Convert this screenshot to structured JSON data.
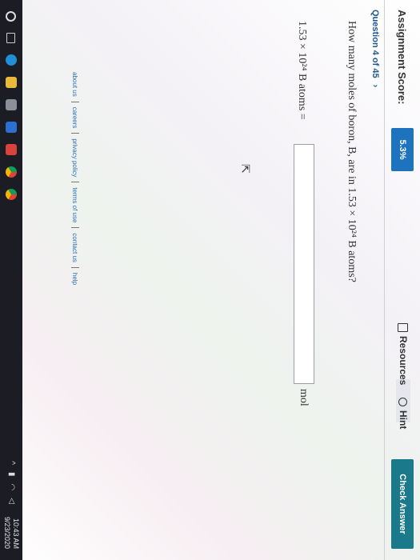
{
  "header": {
    "score_label": "Assignment Score:",
    "score_value": "5.3%",
    "resources_label": "Resources",
    "hint_label": "Hint",
    "check_answer_label": "Check Answer"
  },
  "question_nav": {
    "label": "Question 4 of 45",
    "next_glyph": "›"
  },
  "question": {
    "text": "How many moles of boron, B, are in 1.53 × 10²⁴ B atoms?",
    "answer_prefix": "1.53 × 10²⁴ B atoms =",
    "answer_value": "",
    "unit": "mol"
  },
  "footer": {
    "links": [
      "about us",
      "careers",
      "privacy policy",
      "terms of use",
      "contact us",
      "help"
    ]
  },
  "taskbar": {
    "time": "10:43 AM",
    "date": "9/23/2020"
  },
  "colors": {
    "score_badge": "#1e73be",
    "check_answer": "#1a7a8c",
    "taskbar": "#1b1c24"
  }
}
